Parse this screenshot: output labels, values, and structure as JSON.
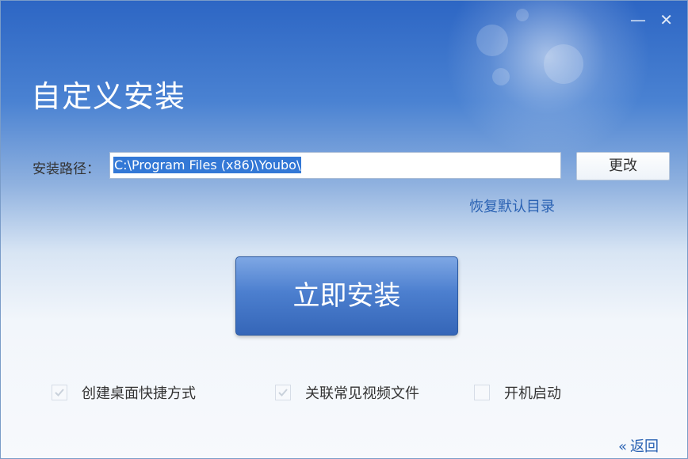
{
  "window": {
    "title": "自定义安装",
    "minimize_glyph": "—",
    "close_glyph": "✕"
  },
  "install_path": {
    "label": "安装路径：",
    "value": "C:\\Program Files (x86)\\Youbo\\",
    "change_button": "更改",
    "restore_default_link": "恢复默认目录"
  },
  "install_button": "立即安装",
  "options": [
    {
      "label": "创建桌面快捷方式",
      "checked": true
    },
    {
      "label": "关联常见视频文件",
      "checked": true
    },
    {
      "label": "开机启动",
      "checked": false
    }
  ],
  "back_link": {
    "icon": "double-chevron-left-icon",
    "label": "返回"
  },
  "colors": {
    "accent": "#2a62b3",
    "button": "#4c7fcf",
    "header": "#2d66c4"
  }
}
